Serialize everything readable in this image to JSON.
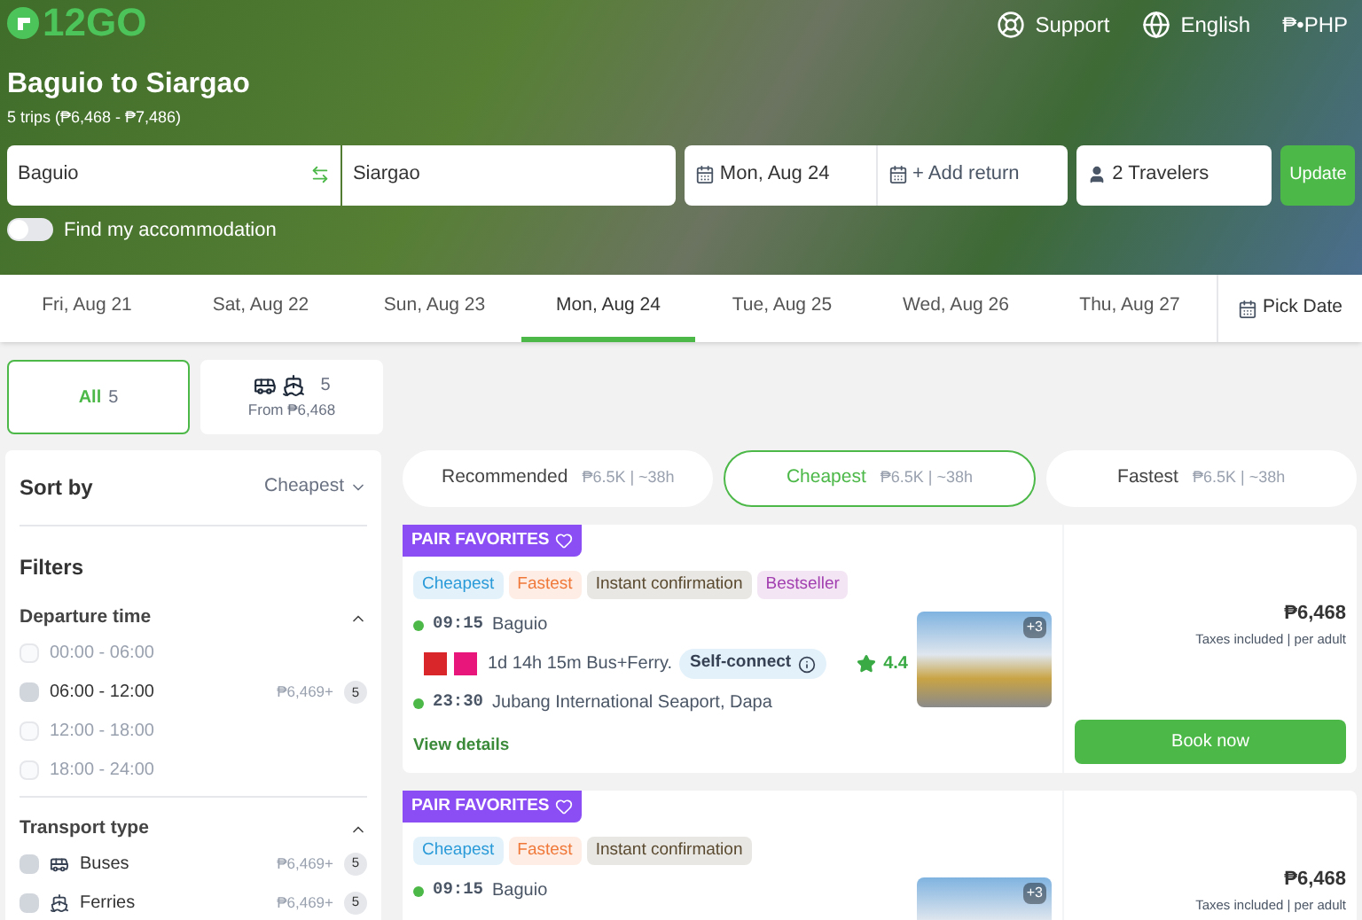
{
  "header": {
    "logo": "12GO",
    "nav": [
      {
        "kind": "support",
        "label": "Support"
      },
      {
        "kind": "language",
        "label": "English"
      },
      {
        "kind": "currency",
        "label": "₱•PHP"
      }
    ],
    "title": "Baguio to Siargao",
    "subtitle": "5 trips (₱6,468 - ₱7,486)"
  },
  "search": {
    "from": "Baguio",
    "to": "Siargao",
    "date": "Mon, Aug 24",
    "return_placeholder": "+ Add return",
    "travelers": "2 Travelers",
    "button": "Update"
  },
  "accommodation_toggle": {
    "label": "Find my accommodation",
    "on": false
  },
  "dates": [
    {
      "label": "Fri, Aug 21",
      "selected": false
    },
    {
      "label": "Sat, Aug 22",
      "selected": false
    },
    {
      "label": "Sun, Aug 23",
      "selected": false
    },
    {
      "label": "Mon, Aug 24",
      "selected": true
    },
    {
      "label": "Tue, Aug 25",
      "selected": false
    },
    {
      "label": "Wed, Aug 26",
      "selected": false
    },
    {
      "label": "Thu, Aug 27",
      "selected": false
    }
  ],
  "pick_date": "Pick Date",
  "mode_tabs": [
    {
      "kind": "all",
      "label": "All",
      "count": "5",
      "selected": true
    },
    {
      "kind": "bus_ferry",
      "count": "5",
      "from": "From ₱6,468",
      "selected": false
    }
  ],
  "sidebar": {
    "sort_label": "Sort by",
    "sort_value": "Cheapest",
    "filters_title": "Filters",
    "groups": [
      {
        "title": "Departure time",
        "expanded": true,
        "options": [
          {
            "label": "00:00 - 06:00",
            "disabled": true,
            "checked": false
          },
          {
            "label": "06:00 - 12:00",
            "disabled": false,
            "checked": false,
            "price": "₱6,469+",
            "count": "5"
          },
          {
            "label": "12:00 - 18:00",
            "disabled": true,
            "checked": false
          },
          {
            "label": "18:00 - 24:00",
            "disabled": true,
            "checked": false
          }
        ]
      },
      {
        "title": "Transport type",
        "expanded": true,
        "options": [
          {
            "label": "Buses",
            "kind": "bus",
            "disabled": false,
            "checked": false,
            "price": "₱6,469+",
            "count": "5"
          },
          {
            "label": "Ferries",
            "kind": "ferry",
            "disabled": false,
            "checked": false,
            "price": "₱6,469+",
            "count": "5"
          }
        ]
      }
    ]
  },
  "sort_tabs": [
    {
      "label": "Recommended",
      "info": "₱6.5K | ~38h",
      "selected": false
    },
    {
      "label": "Cheapest",
      "info": "₱6.5K | ~38h",
      "selected": true
    },
    {
      "label": "Fastest",
      "info": "₱6.5K | ~38h",
      "selected": false
    }
  ],
  "results": [
    {
      "badge": "PAIR FAVORITES",
      "tags": [
        {
          "label": "Cheapest",
          "color": "#2a9ad8"
        },
        {
          "label": "Fastest",
          "color": "#f0793a"
        },
        {
          "label": "Instant confirmation",
          "color": "#5a4a30"
        },
        {
          "label": "Bestseller",
          "color": "#a23fb0"
        }
      ],
      "depart_time": "09:15",
      "depart_place": "Baguio",
      "duration": "1d 14h 15m Bus+Ferry.",
      "connect": "Self-connect",
      "rating": "4.4",
      "arrive_time": "23:30",
      "arrive_place": "Jubang International Seaport, Dapa",
      "link": "View details",
      "photo_more": "+3",
      "price": "₱6,468",
      "price_note": "Taxes included | per adult",
      "button": "Book now"
    },
    {
      "badge": "PAIR FAVORITES",
      "tags": [
        {
          "label": "Cheapest",
          "color": "#2a9ad8"
        },
        {
          "label": "Fastest",
          "color": "#f0793a"
        },
        {
          "label": "Instant confirmation",
          "color": "#5a4a30"
        }
      ],
      "depart_time": "09:15",
      "depart_place": "Baguio",
      "photo_more": "+3",
      "price": "₱6,468",
      "price_note": "Taxes included | per adult"
    }
  ]
}
